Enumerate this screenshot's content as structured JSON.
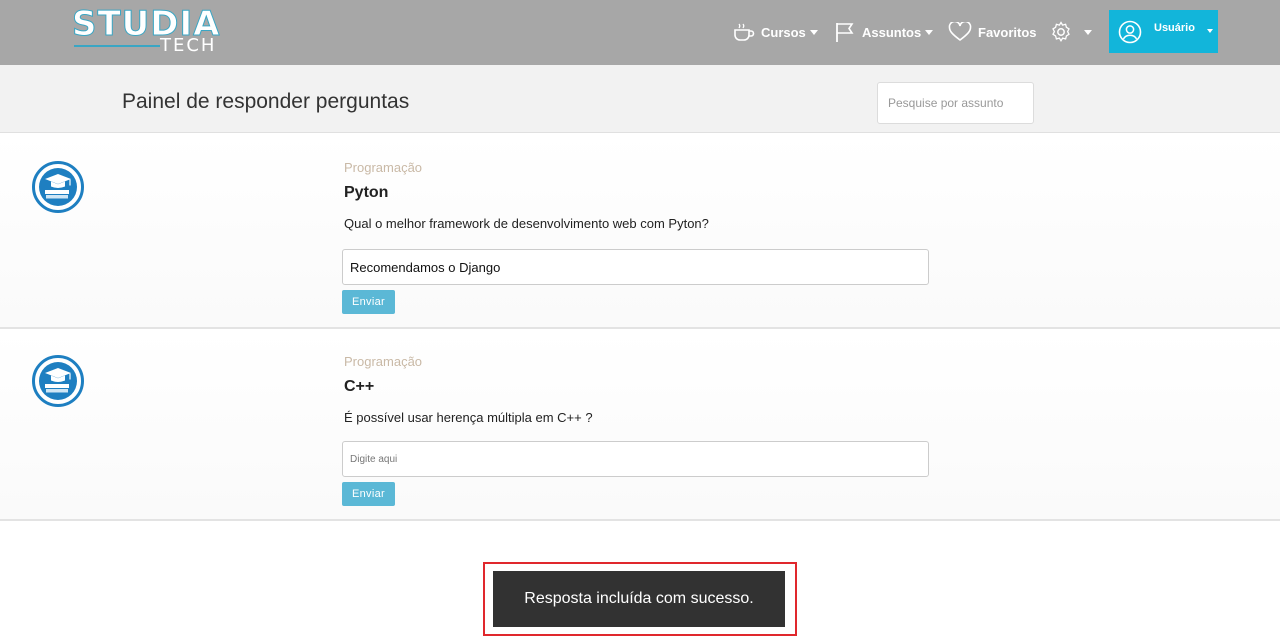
{
  "brand": {
    "logo_main": "STUDIA",
    "logo_sub": "TECH"
  },
  "nav": {
    "cursos": "Cursos",
    "assuntos": "Assuntos",
    "favoritos": "Favoritos",
    "user": "Usuário"
  },
  "panel": {
    "title": "Painel de responder perguntas",
    "search_placeholder": "Pesquise por assunto"
  },
  "questions": [
    {
      "category": "Programação",
      "title": "Pyton",
      "text": "Qual o melhor framework de desenvolvimento web com Pyton?",
      "answer_value": "Recomendamos o Django",
      "answer_placeholder": "Digite aqui",
      "send_label": "Enviar",
      "icon": "graduation-books-icon"
    },
    {
      "category": "Programação",
      "title": "C++",
      "text": "É possível usar herença múltipla em C++ ?",
      "answer_value": "",
      "answer_placeholder": "Digite aqui",
      "send_label": "Enviar",
      "icon": "graduation-books-icon"
    }
  ],
  "toast": {
    "message": "Resposta incluída com sucesso."
  },
  "colors": {
    "topbar": "#a7a7a7",
    "accent": "#12b5da",
    "send_button": "#5bb8d6",
    "toast_bg": "#323232",
    "highlight_border": "#e0282d"
  }
}
